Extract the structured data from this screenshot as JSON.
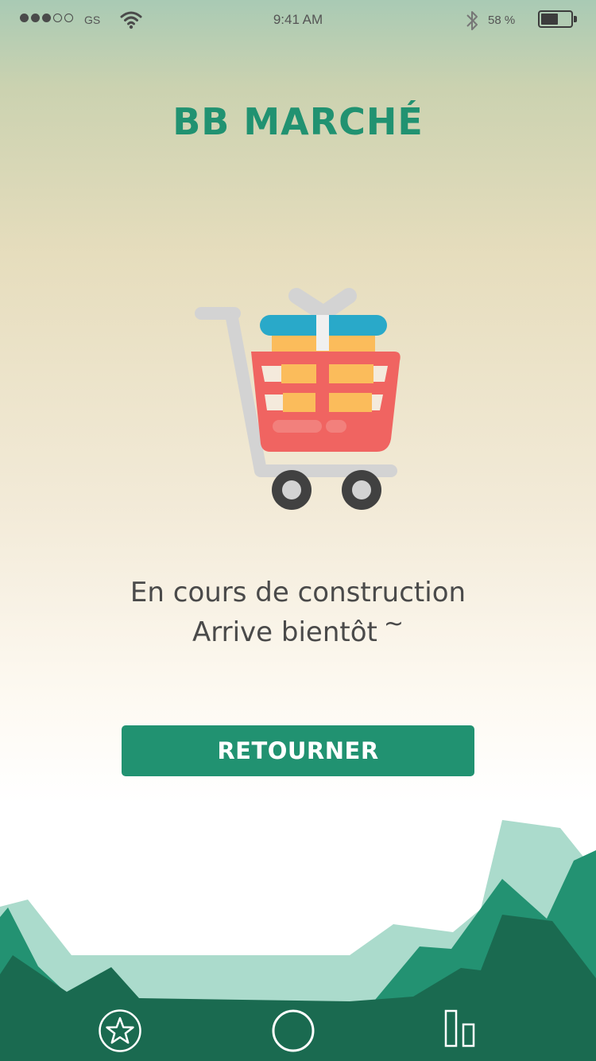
{
  "status_bar": {
    "signal_dots_filled": 3,
    "signal_dots_total": 5,
    "carrier": "GS",
    "time": "9:41 AM",
    "battery_percent_text": "58 %",
    "battery_level": 0.58
  },
  "app": {
    "title": "BB MARCHÉ"
  },
  "illustration": {
    "icon": "shopping-cart-with-gift-icon"
  },
  "message": {
    "line1": "En cours de construction",
    "line2": "Arrive bientôt",
    "line2_suffix": "~"
  },
  "actions": {
    "back_button_label": "RETOURNER"
  },
  "bottom_nav": {
    "items": [
      {
        "icon": "star-icon"
      },
      {
        "icon": "circle-icon"
      },
      {
        "icon": "bar-chart-icon"
      }
    ]
  },
  "colors": {
    "brand_green": "#219271",
    "dark_green": "#1a6a50",
    "mint": "#abdbcc",
    "cart_red": "#f06461",
    "gift_blue": "#29a9c9",
    "gift_orange": "#fbbc5b"
  }
}
